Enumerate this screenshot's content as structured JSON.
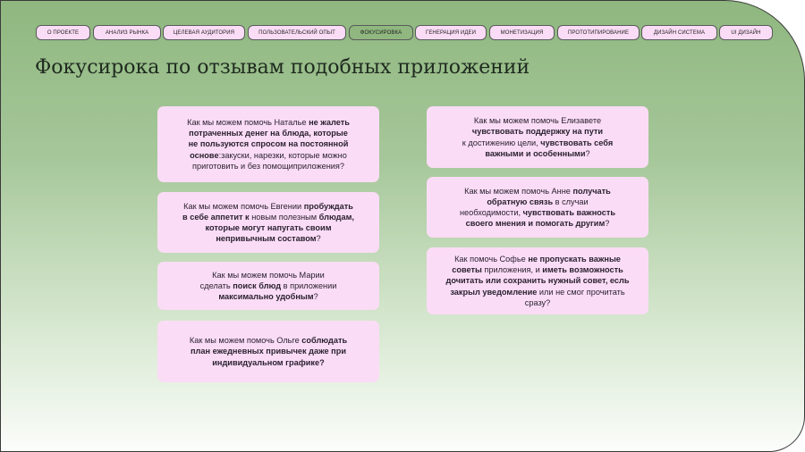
{
  "nav": {
    "items": [
      "О ПРОЕКТЕ",
      "АНАЛИЗ РЫНКА",
      "ЦЕЛЕВАЯ АУДИТОРИЯ",
      "ПОЛЬЗОВАТЕЛЬСКИЙ ОПЫТ",
      "ФОКУСИРОВКА",
      "ГЕНЕРАЦИЯ ИДЕИ",
      "МОНЕТИЗАЦИЯ",
      "ПРОТОТИПИРОВАНИЕ",
      "ДИЗАЙН СИСТЕМА",
      "UI ДИЗАЙН"
    ],
    "active": "ФОКУСИРОВКА"
  },
  "page_title": "Фокусирока по отзывам подобных приложений",
  "colors": {
    "card": "#fbdcf6",
    "accent": "#8fb77f"
  },
  "cards": [
    [
      {
        "t": "Как мы можем помочь Наталье ",
        "b": false
      },
      {
        "t": "не жалеть\nпотраченных денег на блюда, которые\nне пользуются спросом на постоянной\nоснове",
        "b": true
      },
      {
        "t": ":закуски, нарезки, которые можно\nприготовить и без помощиприложения?",
        "b": false
      }
    ],
    [
      {
        "t": "Как мы можем помочь Евгении ",
        "b": false
      },
      {
        "t": "пробуждать\nв себе аппетит к ",
        "b": true
      },
      {
        "t": "новым полезным ",
        "b": false
      },
      {
        "t": "блюдам,\nкоторые могут напугать своим\nнепривычным составом",
        "b": true
      },
      {
        "t": "?",
        "b": false
      }
    ],
    [
      {
        "t": "Как мы можем помочь Марии\nсделать ",
        "b": false
      },
      {
        "t": "поиск блюд",
        "b": true
      },
      {
        "t": " в приложении\n",
        "b": false
      },
      {
        "t": "максимально удобным",
        "b": true
      },
      {
        "t": "?",
        "b": false
      }
    ],
    [
      {
        "t": "Как мы можем помочь Ольге ",
        "b": false
      },
      {
        "t": "соблюдать\nплан ежедневных привычек даже при\nиндивидуальном графике?",
        "b": true
      }
    ],
    [
      {
        "t": "Как мы можем помочь Елизавете\n",
        "b": false
      },
      {
        "t": "чувствовать поддержку на пути",
        "b": true
      },
      {
        "t": "\nк достижению цели, ",
        "b": false
      },
      {
        "t": "чувствовать себя\nважными и особенными",
        "b": true
      },
      {
        "t": "?",
        "b": false
      }
    ],
    [
      {
        "t": "Как мы можем помочь Анне ",
        "b": false
      },
      {
        "t": "получать\nобратную связь",
        "b": true
      },
      {
        "t": " в случаи\nнеобходимости, ",
        "b": false
      },
      {
        "t": "чувствовать важность\nсвоего мнения и помогать другим",
        "b": true
      },
      {
        "t": "?",
        "b": false
      }
    ],
    [
      {
        "t": "Как помочь Софье ",
        "b": false
      },
      {
        "t": "не пропускать важные\nсоветы",
        "b": true
      },
      {
        "t": " приложения, и ",
        "b": false
      },
      {
        "t": "иметь возможность\nдочитать или сохранить нужный совет, есль\nзакрыл уведомление",
        "b": true
      },
      {
        "t": " или не смог прочитать\nсразу?",
        "b": false
      }
    ]
  ]
}
